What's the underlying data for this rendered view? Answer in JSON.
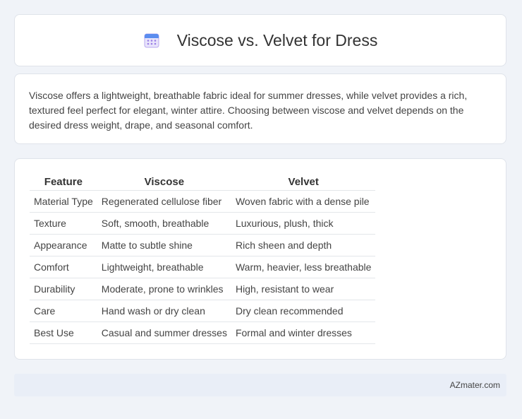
{
  "header": {
    "icon": "calendar-icon",
    "title": "Viscose vs. Velvet for Dress"
  },
  "summary": {
    "text": "Viscose offers a lightweight, breathable fabric ideal for summer dresses, while velvet provides a rich, textured feel perfect for elegant, winter attire. Choosing between viscose and velvet depends on the desired dress weight, drape, and seasonal comfort."
  },
  "table": {
    "headers": [
      "Feature",
      "Viscose",
      "Velvet"
    ],
    "rows": [
      [
        "Material Type",
        "Regenerated cellulose fiber",
        "Woven fabric with a dense pile"
      ],
      [
        "Texture",
        "Soft, smooth, breathable",
        "Luxurious, plush, thick"
      ],
      [
        "Appearance",
        "Matte to subtle shine",
        "Rich sheen and depth"
      ],
      [
        "Comfort",
        "Lightweight, breathable",
        "Warm, heavier, less breathable"
      ],
      [
        "Durability",
        "Moderate, prone to wrinkles",
        "High, resistant to wear"
      ],
      [
        "Care",
        "Hand wash or dry clean",
        "Dry clean recommended"
      ],
      [
        "Best Use",
        "Casual and summer dresses",
        "Formal and winter dresses"
      ]
    ]
  },
  "footer": {
    "source": "AZmater.com"
  },
  "colors": {
    "background": "#f0f3f8",
    "card": "#ffffff",
    "footer_bg": "#e9eef7",
    "icon_blue": "#5b8def",
    "icon_purple": "#9b7fe6"
  }
}
